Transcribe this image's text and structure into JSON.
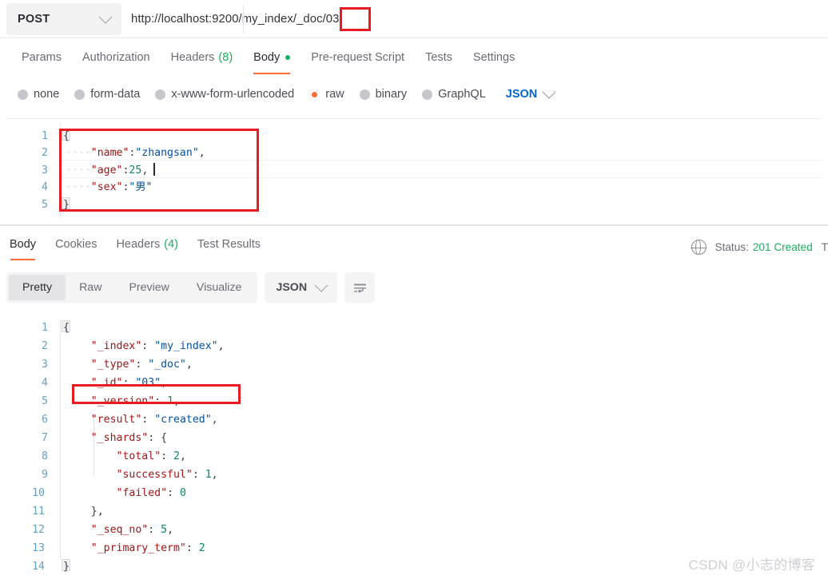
{
  "request": {
    "method": "POST",
    "method_icon": "chevron-down-icon",
    "url": "http://localhost:9200/my_index/_doc/03",
    "url_prefix": "http://localhost:9200/my_index/_doc",
    "url_highlight": "/03",
    "tabs": [
      {
        "label": "Params",
        "active": false
      },
      {
        "label": "Authorization",
        "active": false
      },
      {
        "label": "Headers",
        "count": "(8)",
        "active": false
      },
      {
        "label": "Body",
        "active": true,
        "dot": true
      },
      {
        "label": "Pre-request Script",
        "active": false
      },
      {
        "label": "Tests",
        "active": false
      },
      {
        "label": "Settings",
        "active": false
      }
    ],
    "body_types": [
      {
        "label": "none",
        "selected": false
      },
      {
        "label": "form-data",
        "selected": false
      },
      {
        "label": "x-www-form-urlencoded",
        "selected": false
      },
      {
        "label": "raw",
        "selected": true
      },
      {
        "label": "binary",
        "selected": false
      },
      {
        "label": "GraphQL",
        "selected": false
      }
    ],
    "language": "JSON",
    "language_icon": "chevron-down-icon",
    "editor": {
      "line_numbers": [
        "1",
        "2",
        "3",
        "4",
        "5"
      ],
      "lines": [
        {
          "indent": "",
          "key": "",
          "punct_open": "{"
        },
        {
          "indent": "····",
          "key": "\"name\"",
          "colon": ":",
          "value": "\"zhangsan\"",
          "value_type": "string",
          "comma": ","
        },
        {
          "indent": "····",
          "key": "\"age\"",
          "colon": ":",
          "value": "25",
          "value_type": "number",
          "comma": ","
        },
        {
          "indent": "····",
          "key": "\"sex\"",
          "colon": ":",
          "value": "\"男\"",
          "value_type": "string",
          "comma": ""
        },
        {
          "indent": "",
          "key": "",
          "punct_close": "}"
        }
      ]
    }
  },
  "response": {
    "tabs": [
      {
        "label": "Body",
        "active": true
      },
      {
        "label": "Cookies",
        "active": false
      },
      {
        "label": "Headers",
        "count": "(4)",
        "active": false
      },
      {
        "label": "Test Results",
        "active": false
      }
    ],
    "status_label": "Status:",
    "status_value": "201 Created",
    "status_color": "#1aaf5d",
    "time_label_truncated": "T",
    "globe_icon": "globe-icon",
    "view_modes": [
      {
        "label": "Pretty",
        "active": true
      },
      {
        "label": "Raw",
        "active": false
      },
      {
        "label": "Preview",
        "active": false
      },
      {
        "label": "Visualize",
        "active": false
      }
    ],
    "format": "JSON",
    "format_icon": "chevron-down-icon",
    "wrap_icon": "wrap-lines-icon",
    "editor": {
      "line_numbers": [
        "1",
        "2",
        "3",
        "4",
        "5",
        "6",
        "7",
        "8",
        "9",
        "10",
        "11",
        "12",
        "13",
        "14"
      ],
      "lines": [
        {
          "text_punct": "{"
        },
        {
          "indent": "    ",
          "key": "\"_index\"",
          "colon": ": ",
          "value": "\"my_index\"",
          "value_type": "string",
          "comma": ","
        },
        {
          "indent": "    ",
          "key": "\"_type\"",
          "colon": ": ",
          "value": "\"_doc\"",
          "value_type": "string",
          "comma": ","
        },
        {
          "indent": "    ",
          "key": "\"_id\"",
          "colon": ": ",
          "value": "\"03\"",
          "value_type": "string",
          "comma": ","
        },
        {
          "indent": "    ",
          "key": "\"_version\"",
          "colon": ": ",
          "value": "1",
          "value_type": "number",
          "comma": ","
        },
        {
          "indent": "    ",
          "key": "\"result\"",
          "colon": ": ",
          "value": "\"created\"",
          "value_type": "string",
          "comma": ","
        },
        {
          "indent": "    ",
          "key": "\"_shards\"",
          "colon": ": ",
          "value": "{",
          "value_type": "punct",
          "comma": ""
        },
        {
          "indent": "        ",
          "key": "\"total\"",
          "colon": ": ",
          "value": "2",
          "value_type": "number",
          "comma": ","
        },
        {
          "indent": "        ",
          "key": "\"successful\"",
          "colon": ": ",
          "value": "1",
          "value_type": "number",
          "comma": ","
        },
        {
          "indent": "        ",
          "key": "\"failed\"",
          "colon": ": ",
          "value": "0",
          "value_type": "number",
          "comma": ""
        },
        {
          "indent": "    ",
          "key": "",
          "colon": "",
          "value": "},",
          "value_type": "punct",
          "comma": ""
        },
        {
          "indent": "    ",
          "key": "\"_seq_no\"",
          "colon": ": ",
          "value": "5",
          "value_type": "number",
          "comma": ","
        },
        {
          "indent": "    ",
          "key": "\"_primary_term\"",
          "colon": ": ",
          "value": "2",
          "value_type": "number",
          "comma": ""
        },
        {
          "text_punct": "}"
        }
      ]
    }
  },
  "watermark": "CSDN @小志的博客"
}
